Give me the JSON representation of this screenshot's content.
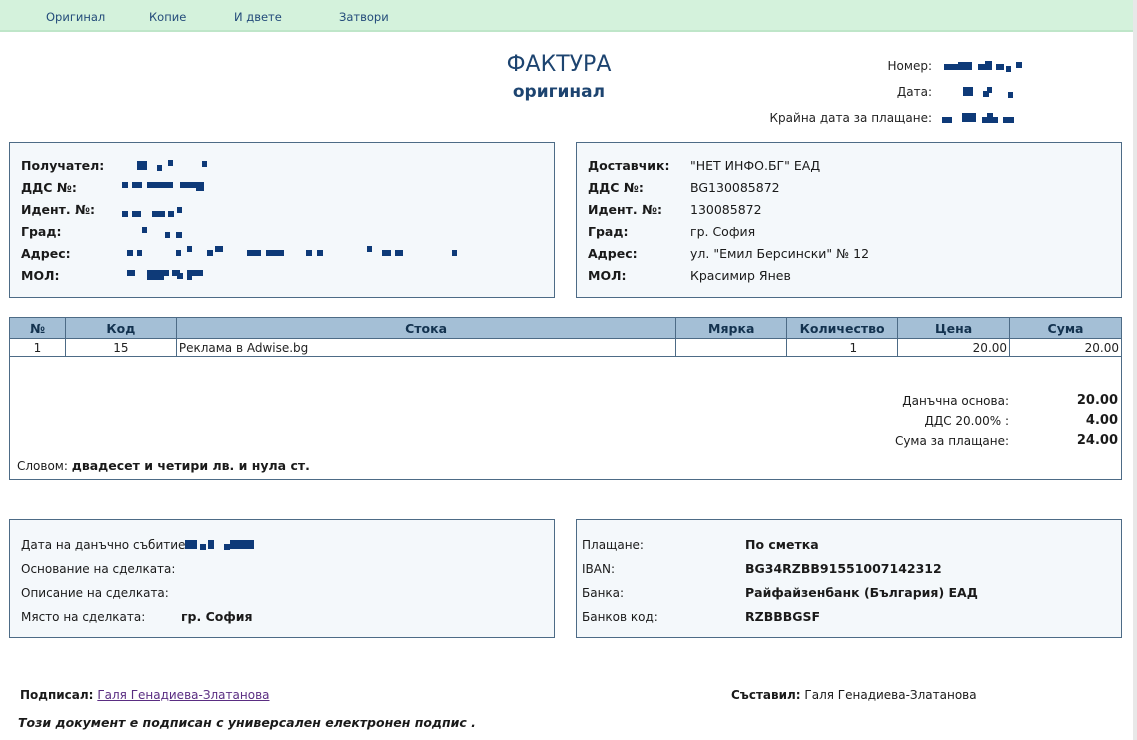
{
  "toolbar": {
    "original": "Оригинал",
    "copy": "Копие",
    "both": "И двете",
    "close": "Затвори"
  },
  "header": {
    "title": "ФАКТУРА",
    "subtitle": "оригинал",
    "number_label": "Номер:",
    "date_label": "Дата:",
    "due_label": "Крайна дата за плащане:"
  },
  "recipient": {
    "name_label": "Получател:",
    "vat_label": "ДДС №:",
    "id_label": "Идент. №:",
    "city_label": "Град:",
    "address_label": "Адрес:",
    "mol_label": "МОЛ:"
  },
  "supplier": {
    "name_label": "Доставчик:",
    "name": "\"НЕТ ИНФО.БГ\" ЕАД",
    "vat_label": "ДДС №:",
    "vat": "BG130085872",
    "id_label": "Идент. №:",
    "id": "130085872",
    "city_label": "Град:",
    "city": "гр. София",
    "address_label": "Адрес:",
    "address": "ул. \"Емил Берсински\" № 12",
    "mol_label": "МОЛ:",
    "mol": "Красимир Янев"
  },
  "items": {
    "headers": [
      "№",
      "Код",
      "Стока",
      "Мярка",
      "Количество",
      "Цена",
      "Сума"
    ],
    "rows": [
      {
        "no": "1",
        "code": "15",
        "product": "Реклама в Adwise.bg",
        "unit": "",
        "qty": "1",
        "price": "20.00",
        "sum": "20.00"
      }
    ]
  },
  "totals": {
    "base_label": "Данъчна основа:",
    "base": "20.00",
    "vat_label": "ДДС 20.00% :",
    "vat": "4.00",
    "total_label": "Сума за плащане:",
    "total": "24.00",
    "words_label": "Словом:",
    "words": "двадесет и четири лв. и нула ст."
  },
  "deal": {
    "event_date_label": "Дата на данъчно събитие:",
    "basis_label": "Основание на сделката:",
    "description_label": "Описание на сделката:",
    "place_label": "Място на сделката:",
    "place": "гр. София"
  },
  "payment": {
    "method_label": "Плащане:",
    "method": "По сметка",
    "iban_label": "IBAN:",
    "iban": "BG34RZBB91551007142312",
    "bank_label": "Банка:",
    "bank": "Райфайзенбанк (България) ЕАД",
    "bank_code_label": "Банков код:",
    "bank_code": "RZBBBGSF"
  },
  "footer": {
    "signed_label": "Подписал:",
    "signed_by": "Галя Генадиева-Златанова",
    "compiled_label": "Съставил:",
    "compiled_by": "Галя Генадиева-Златанова",
    "esign_note": "Този документ е подписан с универсален електронен подпис ."
  },
  "colors": {
    "toolbar_bg": "#d4f2dc",
    "title": "#1d4470",
    "table_header": "#a4bfd6",
    "box_bg": "#f4f8fb",
    "border": "#4d6b86",
    "redaction": "#0e3a78"
  }
}
